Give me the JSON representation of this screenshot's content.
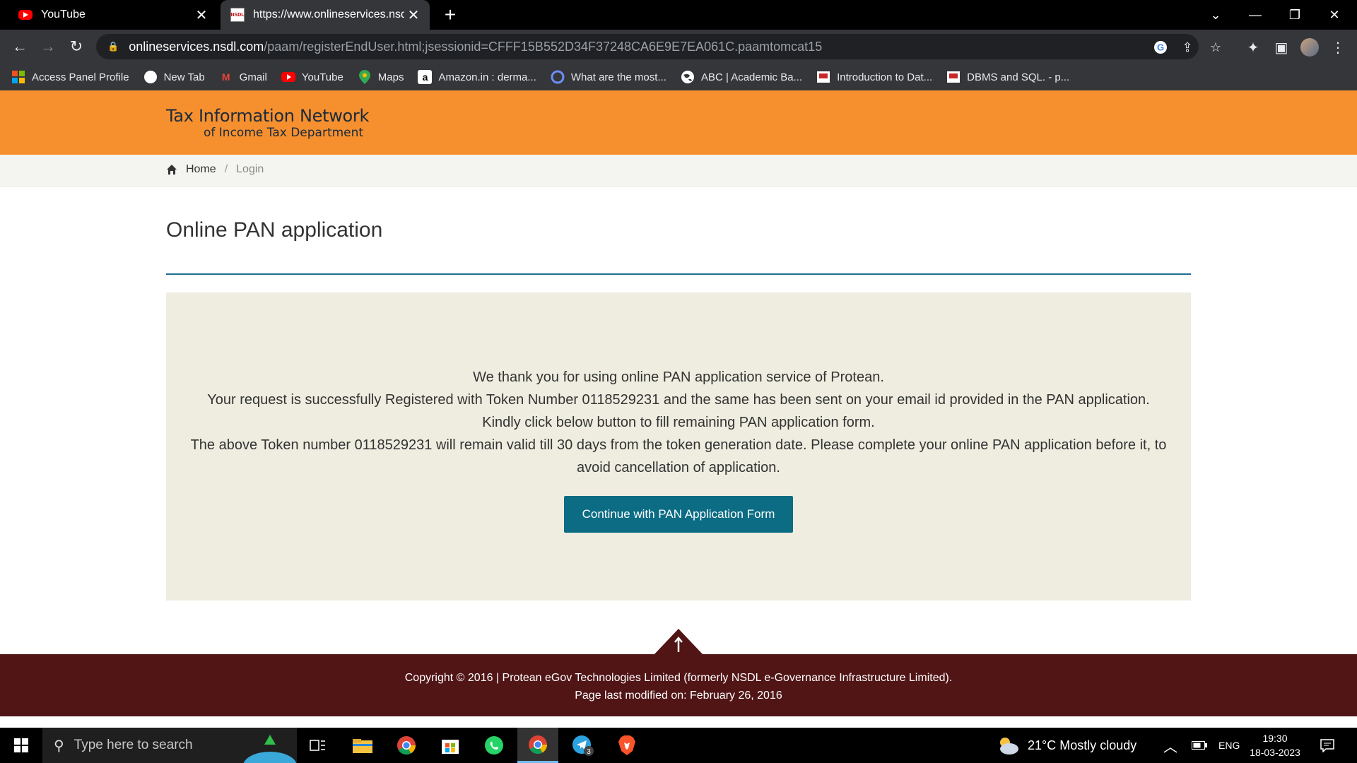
{
  "browser": {
    "tabs": [
      {
        "title": "YouTube",
        "favicon": "youtube-icon"
      },
      {
        "title": "https://www.onlineservices.nsdl.co",
        "favicon": "nsdl-icon",
        "favicon_text": "NSDL"
      }
    ],
    "new_tab_label": "+",
    "url_host": "onlineservices.nsdl.com",
    "url_path": "/paam/registerEndUser.html;jsessionid=CFFF15B552D34F37248CA6E9E7EA061C.paamtomcat15",
    "bookmarks": [
      {
        "label": "Access Panel Profile",
        "icon": "microsoft-icon"
      },
      {
        "label": "New Tab",
        "icon": "circle-icon"
      },
      {
        "label": "Gmail",
        "icon": "gmail-icon"
      },
      {
        "label": "YouTube",
        "icon": "youtube-icon"
      },
      {
        "label": "Maps",
        "icon": "maps-icon"
      },
      {
        "label": "Amazon.in : derma...",
        "icon": "amazon-icon"
      },
      {
        "label": "What are the most...",
        "icon": "quora-icon"
      },
      {
        "label": "ABC | Academic Ba...",
        "icon": "globe-icon"
      },
      {
        "label": "Introduction to Dat...",
        "icon": "slides-icon"
      },
      {
        "label": "DBMS and SQL. - p...",
        "icon": "slides-icon"
      }
    ]
  },
  "site": {
    "brand_line1": "Tax Information Network",
    "brand_line2": "of Income Tax Department",
    "breadcrumb": {
      "home": "Home",
      "separator": "/",
      "current": "Login"
    },
    "page_title": "Online PAN application",
    "message_lines": [
      "We thank you for using online PAN application service of Protean.",
      "Your request is successfully Registered with Token Number 0118529231 and the same has been sent on your email id provided in the PAN application.",
      "Kindly click below button to fill remaining PAN application form.",
      "The above Token number 0118529231 will remain valid till 30 days from the token generation date. Please complete your online PAN application before it, to avoid cancellation of application."
    ],
    "continue_button": "Continue with PAN Application Form",
    "footer_copyright": "Copyright © 2016 | Protean eGov Technologies Limited (formerly NSDL e-Governance Infrastructure Limited).",
    "footer_modified": "Page last modified on: February 26, 2016"
  },
  "taskbar": {
    "search_placeholder": "Type here to search",
    "telegram_badge": "3",
    "weather": "21°C  Mostly cloudy",
    "language": "ENG",
    "time": "19:30",
    "date": "18-03-2023"
  },
  "colors": {
    "header_orange": "#f6902f",
    "footer_maroon": "#511516",
    "button_teal": "#0b6c84",
    "panel_beige": "#eeede0"
  }
}
